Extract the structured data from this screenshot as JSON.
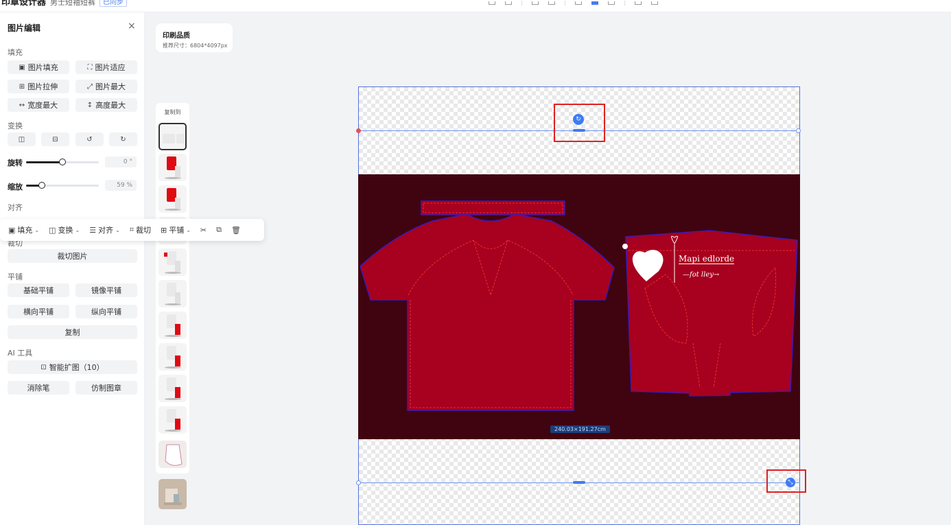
{
  "app": {
    "title": "印章设计器",
    "subtitle": "男士短袖短裤",
    "tag": "已同步"
  },
  "panel": {
    "title": "图片编辑",
    "sections": {
      "fill": "填充",
      "transform": "变换",
      "align": "对齐",
      "crop": "裁切",
      "tile": "平铺",
      "ai": "AI 工具"
    },
    "fill_buttons": [
      "图片填充",
      "图片适应",
      "图片拉伸",
      "图片最大",
      "宽度最大",
      "高度最大"
    ],
    "rotate": {
      "label": "旋转",
      "value": "0",
      "unit": "°",
      "fraction": 0.5
    },
    "scale": {
      "label": "缩放",
      "value": "59",
      "unit": "%",
      "fraction": 0.22
    },
    "crop_button": "裁切图片",
    "tile_buttons": [
      "基础平铺",
      "镜像平铺",
      "横向平铺",
      "纵向平铺"
    ],
    "copy_button": "复制",
    "ai_button": "智能扩图（10）",
    "ai_buttons": [
      "消除笔",
      "仿制图章"
    ]
  },
  "toolbar": {
    "fill": "填充",
    "transform": "变换",
    "align": "对齐",
    "crop": "裁切",
    "tile": "平铺"
  },
  "quality": {
    "title": "印刷品质",
    "size": "推荐尺寸：6804*4097px"
  },
  "thumbs": {
    "label": "复制到"
  },
  "canvas": {
    "dimension": "240.03×191.27cm",
    "logo_line1": "Mapi edlorde",
    "logo_line2": "—fot lley→"
  },
  "colors": {
    "accent": "#3e7bf5",
    "garment": "#a8001f",
    "design_bg": "#400410",
    "highlight": "#e02020"
  }
}
